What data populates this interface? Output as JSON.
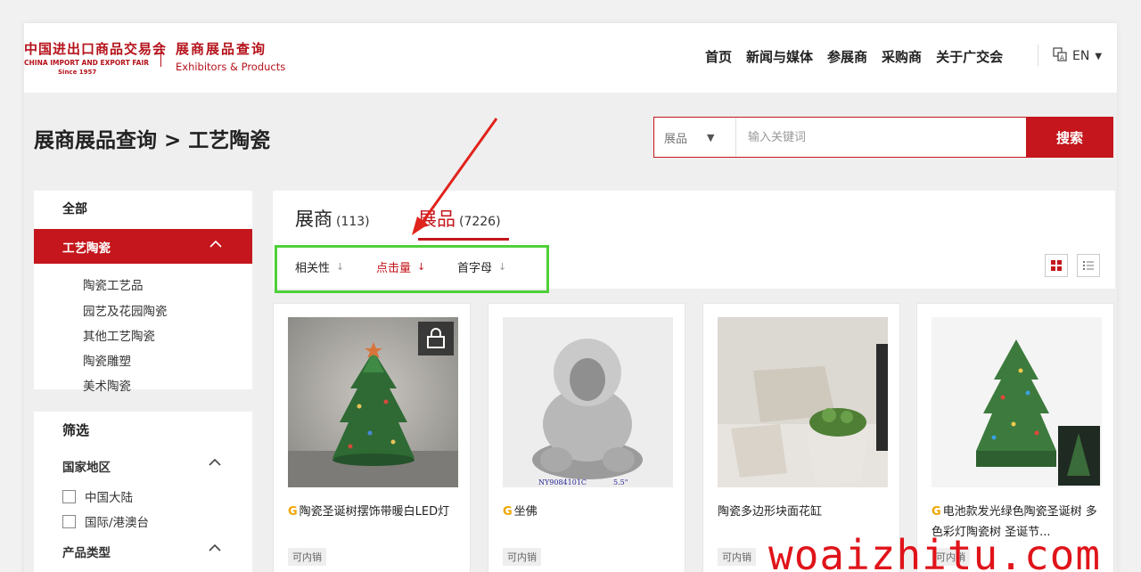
{
  "logo": {
    "cn": "中国进出口商品交易会",
    "en": "CHINA IMPORT AND EXPORT FAIR",
    "since": "Since 1957"
  },
  "brand": {
    "cn": "展商展品查询",
    "en": "Exhibitors & Products"
  },
  "nav": {
    "items": [
      "首页",
      "新闻与媒体",
      "参展商",
      "采购商",
      "关于广交会"
    ]
  },
  "lang": {
    "label": "EN"
  },
  "page_title": "展商展品查询 > 工艺陶瓷",
  "search": {
    "select_value": "展品",
    "placeholder": "输入关键词",
    "button": "搜索"
  },
  "categories": {
    "all": "全部",
    "active": "工艺陶瓷",
    "subs": [
      "陶瓷工艺品",
      "园艺及花园陶瓷",
      "其他工艺陶瓷",
      "陶瓷雕塑",
      "美术陶瓷"
    ]
  },
  "filter": {
    "title": "筛选",
    "region_label": "国家地区",
    "regions": [
      "中国大陆",
      "国际/港澳台"
    ],
    "type_label": "产品类型"
  },
  "tabs": {
    "exhibitors": {
      "label": "展商",
      "count": "(113)"
    },
    "products": {
      "label": "展品",
      "count": "(7226)"
    }
  },
  "sort": {
    "relevance": "相关性",
    "clicks": "点击量",
    "alpha": "首字母",
    "arrow": "↓"
  },
  "products": [
    {
      "name": "陶瓷圣诞树摆饰带暖白LED灯",
      "tag": "G",
      "badge": "可内销"
    },
    {
      "name": "坐佛",
      "tag": "G",
      "badge": "可内销",
      "img_caption_left": "NY9084101C",
      "img_caption_right": "5.5\""
    },
    {
      "name": "陶瓷多边形块面花缸",
      "tag": "",
      "badge": "可内销"
    },
    {
      "name": "电池款发光绿色陶瓷圣诞树 多色彩灯陶瓷树 圣诞节...",
      "tag": "G",
      "badge": "可内销"
    }
  ],
  "watermark": "woaizhitu.com",
  "colors": {
    "accent": "#c4161c",
    "highlight_box": "#4fcf3a",
    "arrow": "#e0231b"
  }
}
